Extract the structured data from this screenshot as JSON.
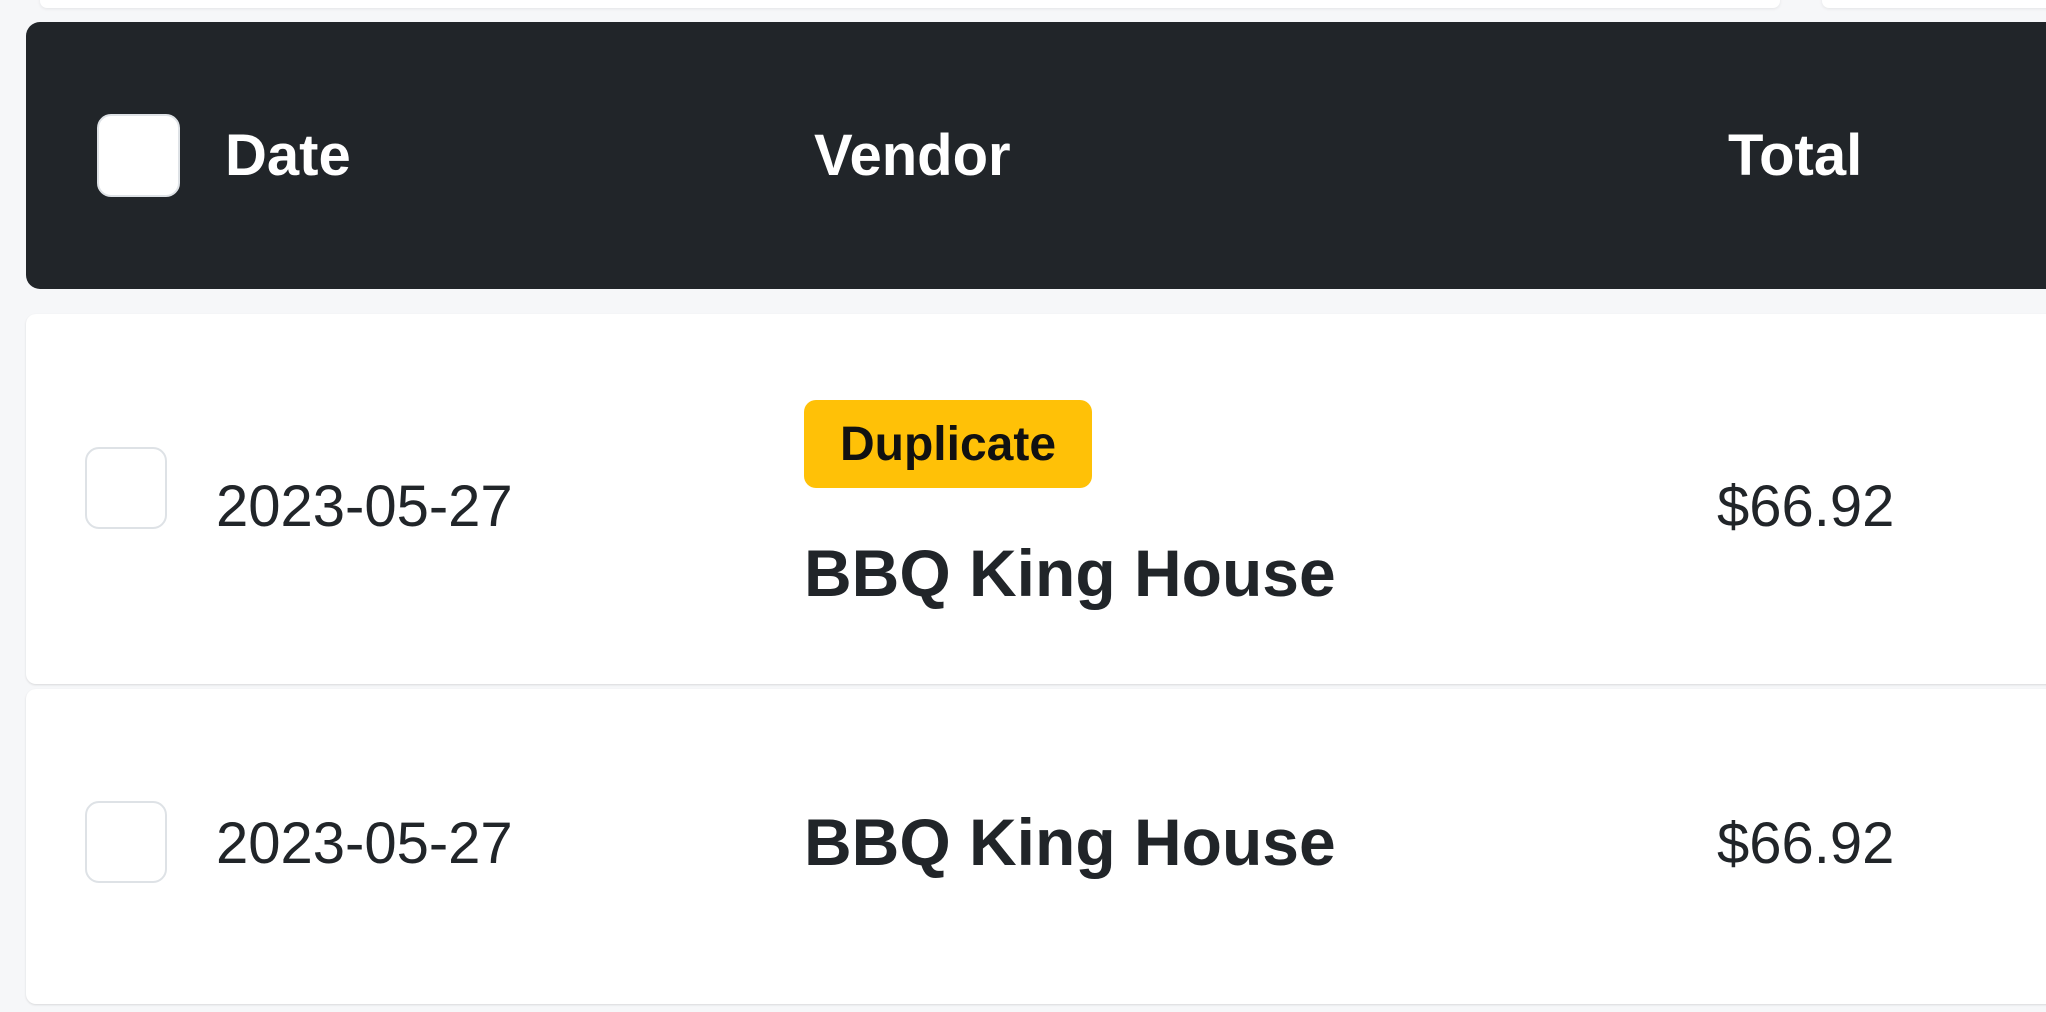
{
  "table": {
    "columns": {
      "date": "Date",
      "vendor": "Vendor",
      "total": "Total"
    },
    "rows": [
      {
        "date": "2023-05-27",
        "badge": "Duplicate",
        "vendor": "BBQ King House",
        "total": "$66.92",
        "checked": false
      },
      {
        "date": "2023-05-27",
        "badge": "",
        "vendor": "BBQ King House",
        "total": "$66.92",
        "checked": false
      }
    ]
  },
  "colors": {
    "header_bg": "#212529",
    "badge_bg": "#ffc107",
    "page_bg": "#f6f7f9"
  }
}
